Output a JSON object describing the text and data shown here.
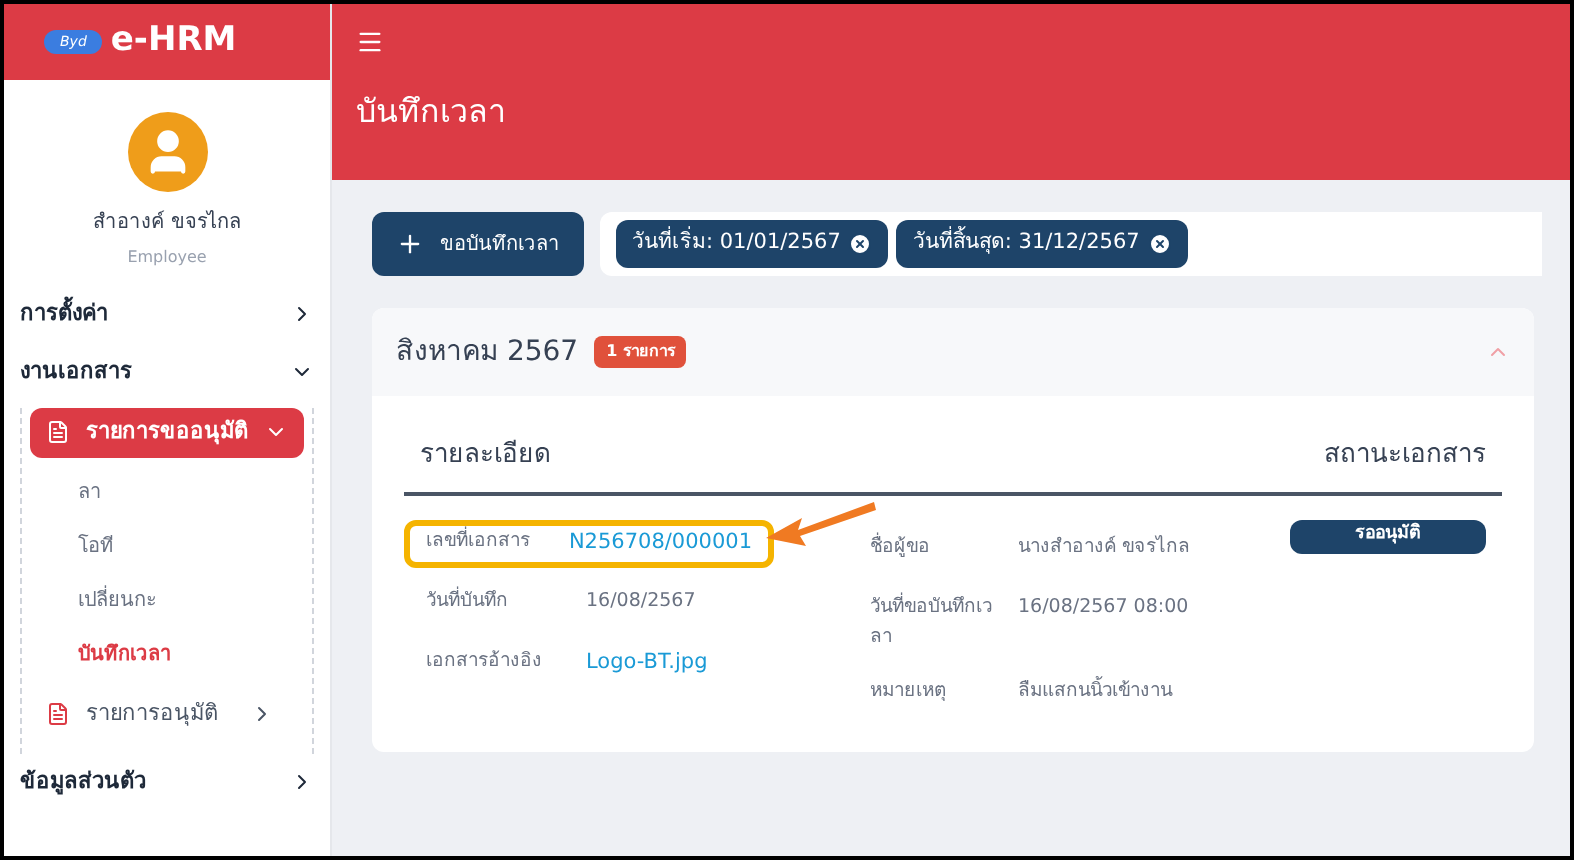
{
  "app": {
    "name": "e-HRM",
    "logo_text": "Byd"
  },
  "user": {
    "name": "สำอางค์ ขจรไกล",
    "role": "Employee"
  },
  "sidebar": {
    "items": [
      {
        "label": "การตั้งค่า",
        "expanded": false
      },
      {
        "label": "งานเอกสาร",
        "expanded": true,
        "children": [
          {
            "label": "รายการขออนุมัติ",
            "expanded": true,
            "selected": true,
            "children": [
              {
                "label": "ลา",
                "selected": false
              },
              {
                "label": "โอที",
                "selected": false
              },
              {
                "label": "เปลี่ยนกะ",
                "selected": false
              },
              {
                "label": "บันทึกเวลา",
                "selected": true
              }
            ]
          },
          {
            "label": "รายการอนุมัติ",
            "expanded": false,
            "selected": false
          }
        ]
      },
      {
        "label": "ข้อมูลส่วนตัว",
        "expanded": false
      }
    ]
  },
  "page_title": "บันทึกเวลา",
  "add_button": "ขอบันทึกเวลา",
  "filters": [
    "วันที่เริ่ม: 01/01/2567",
    "วันที่สิ้นสุด: 31/12/2567"
  ],
  "group": {
    "title": "สิงหาคม 2567",
    "count_badge": "1 รายการ",
    "expanded": true
  },
  "details": {
    "heading": "รายละเอียด",
    "status_heading": "สถานะเอกสาร",
    "status": "รออนุมัติ",
    "left": [
      {
        "label": "เลขที่เอกสาร",
        "value": "N256708/000001",
        "kind": "link",
        "highlighted": true
      },
      {
        "label": "วันที่บันทึก",
        "value": "16/08/2567",
        "kind": "text",
        "highlighted": false
      },
      {
        "label": "เอกสารอ้างอิง",
        "value": "Logo-BT.jpg",
        "kind": "link",
        "highlighted": false
      }
    ],
    "right": [
      {
        "label": "ชื่อผู้ขอ",
        "value": "นางสำอางค์ ขจรไกล",
        "kind": "text"
      },
      {
        "label": "วันที่ขอบันทึกเวลา",
        "value": "16/08/2567 08:00",
        "kind": "text"
      },
      {
        "label": "หมายเหตุ",
        "value": "ลืมแสกนนิ้วเข้างาน",
        "kind": "text"
      }
    ]
  }
}
